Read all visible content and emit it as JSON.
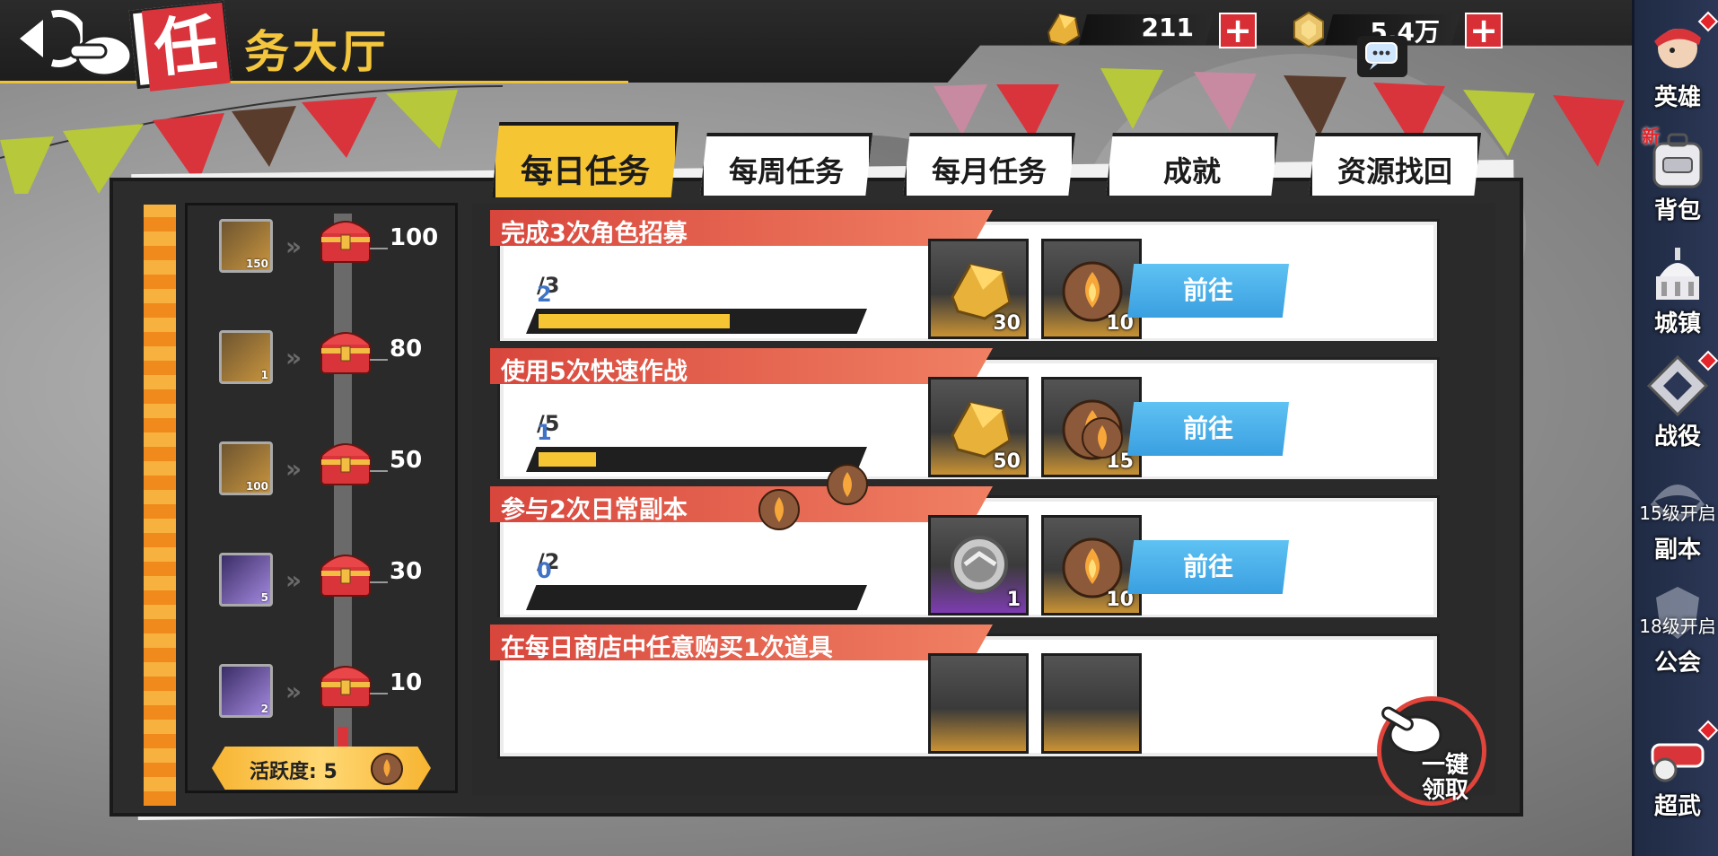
{
  "header": {
    "title_first_char": "任",
    "title_rest": "务大厅"
  },
  "currencies": [
    {
      "icon": "gold-ore-icon",
      "value": "211"
    },
    {
      "icon": "gold-coin-icon",
      "value": "5.4万"
    }
  ],
  "tabs": [
    {
      "label": "每日任务",
      "active": true
    },
    {
      "label": "每周任务",
      "active": false
    },
    {
      "label": "每月任务",
      "active": false
    },
    {
      "label": "成就",
      "active": false
    },
    {
      "label": "资源找回",
      "active": false
    }
  ],
  "milestones": [
    {
      "item": "gold-ore-icon",
      "qty": "150",
      "score": "100"
    },
    {
      "item": "gold-card-icon",
      "qty": "1",
      "score": "80"
    },
    {
      "item": "gold-ore-icon",
      "qty": "100",
      "score": "50"
    },
    {
      "item": "purple-card-icon",
      "qty": "5",
      "score": "30"
    },
    {
      "item": "purple-card-icon",
      "qty": "2",
      "score": "10"
    }
  ],
  "activity": {
    "label": "活跃度: 5",
    "progress": 0.05
  },
  "tasks": [
    {
      "title": "完成3次角色招募",
      "current": "2",
      "total": "/3",
      "progress": 0.6667,
      "rewards": [
        {
          "icon": "gold-ore-icon",
          "count": "30"
        },
        {
          "icon": "fire-orb-icon",
          "count": "10"
        }
      ],
      "button": "前往"
    },
    {
      "title": "使用5次快速作战",
      "current": "1",
      "total": "/5",
      "progress": 0.2,
      "rewards": [
        {
          "icon": "gold-ore-icon",
          "count": "50"
        },
        {
          "icon": "fire-orb-icon",
          "count": "15"
        }
      ],
      "button": "前往"
    },
    {
      "title": "参与2次日常副本",
      "current": "0",
      "total": "/2",
      "progress": 0,
      "rewards": [
        {
          "icon": "silver-medal-icon",
          "count": "1"
        },
        {
          "icon": "fire-orb-icon",
          "count": "10"
        }
      ],
      "button": "前往"
    },
    {
      "title": "在每日商店中任意购买1次道具",
      "current": "",
      "total": "",
      "progress": 0,
      "rewards": [],
      "button": ""
    }
  ],
  "claim_all": {
    "line1": "一键",
    "line2": "领取"
  },
  "sidebar": [
    {
      "label": "英雄",
      "icon": "hero-icon",
      "badge": true,
      "lock": ""
    },
    {
      "label": "背包",
      "icon": "backpack-icon",
      "badge": false,
      "lock": "",
      "new": "新"
    },
    {
      "label": "城镇",
      "icon": "town-icon",
      "badge": false,
      "lock": ""
    },
    {
      "label": "战役",
      "icon": "battle-icon",
      "badge": true,
      "lock": ""
    },
    {
      "label": "副本",
      "icon": "dungeon-icon",
      "badge": false,
      "lock": "15级开启"
    },
    {
      "label": "公会",
      "icon": "guild-icon",
      "badge": false,
      "lock": "18级开启"
    },
    {
      "label": "超武",
      "icon": "super-weapon-icon",
      "badge": true,
      "lock": ""
    }
  ],
  "colors": {
    "accent": "#f6c534",
    "red": "#d8343a",
    "blue": "#3fa6e8",
    "dark": "#2a2a2a"
  }
}
